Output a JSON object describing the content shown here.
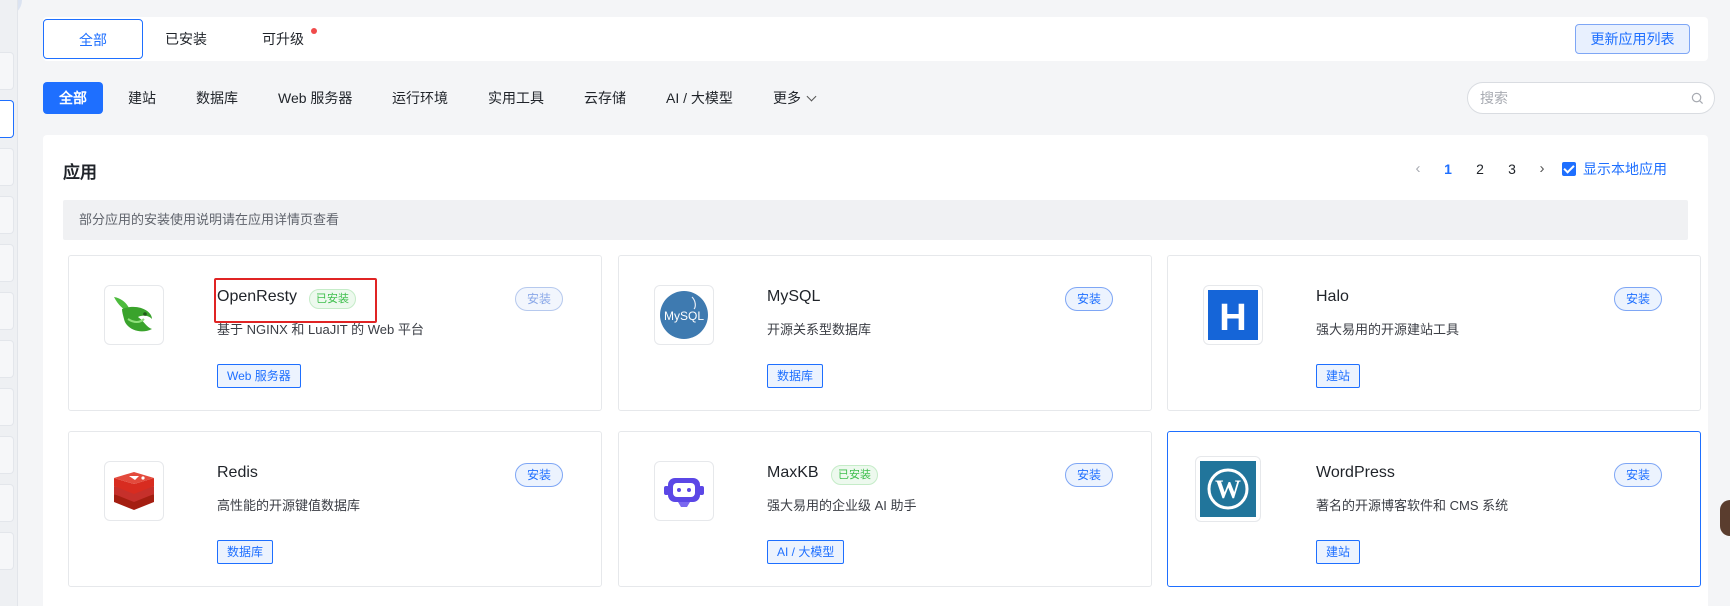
{
  "top_tabs": [
    {
      "label": "全部",
      "active": true
    },
    {
      "label": "已安装",
      "active": false
    },
    {
      "label": "可升级",
      "active": false,
      "has_dot": true
    }
  ],
  "refresh_button": "更新应用列表",
  "categories": [
    {
      "label": "全部",
      "active": true
    },
    {
      "label": "建站"
    },
    {
      "label": "数据库"
    },
    {
      "label": "Web 服务器"
    },
    {
      "label": "运行环境"
    },
    {
      "label": "实用工具"
    },
    {
      "label": "云存储"
    },
    {
      "label": "AI / 大模型"
    },
    {
      "label": "更多"
    }
  ],
  "search": {
    "placeholder": "搜索"
  },
  "panel": {
    "title": "应用",
    "pagination": {
      "prev": "‹",
      "pages": [
        "1",
        "2",
        "3"
      ],
      "current": "1",
      "next": "›"
    },
    "show_local_label": "显示本地应用",
    "show_local_checked": true,
    "notice": "部分应用的安装使用说明请在应用详情页查看"
  },
  "apps": [
    {
      "name": "OpenResty",
      "installed": true,
      "installed_label": "已安装",
      "desc": "基于 NGINX 和 LuaJIT 的 Web 平台",
      "tag": "Web 服务器",
      "install_label": "安装",
      "icon": "openresty-logo-icon",
      "install_disabled": true,
      "highlighted": true
    },
    {
      "name": "MySQL",
      "installed": false,
      "desc": "开源关系型数据库",
      "tag": "数据库",
      "install_label": "安装",
      "icon": "mysql-logo-icon",
      "logo_text": "MySQL"
    },
    {
      "name": "Halo",
      "installed": false,
      "desc": "强大易用的开源建站工具",
      "tag": "建站",
      "install_label": "安装",
      "icon": "halo-logo-icon",
      "logo_text": "H"
    },
    {
      "name": "Redis",
      "installed": false,
      "desc": "高性能的开源键值数据库",
      "tag": "数据库",
      "install_label": "安装",
      "icon": "redis-logo-icon"
    },
    {
      "name": "MaxKB",
      "installed": true,
      "installed_label": "已安装",
      "desc": "强大易用的企业级 AI 助手",
      "tag": "AI / 大模型",
      "install_label": "安装",
      "icon": "maxkb-logo-icon"
    },
    {
      "name": "WordPress",
      "installed": false,
      "desc": "著名的开源博客软件和 CMS 系统",
      "tag": "建站",
      "install_label": "安装",
      "icon": "wordpress-logo-icon",
      "selected": true
    }
  ],
  "colors": {
    "accent": "#1e6fff",
    "installed_green": "#3fbf4d",
    "highlight_red": "#e02424",
    "badge_dot": "#f04b4b"
  }
}
